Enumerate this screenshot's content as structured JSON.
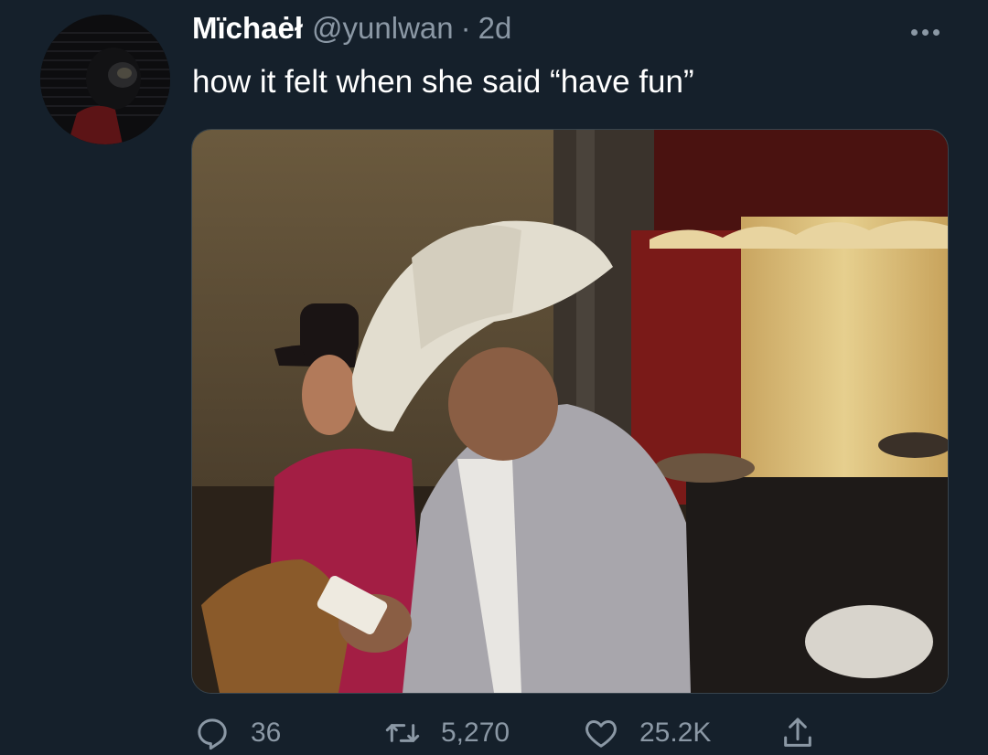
{
  "tweet": {
    "display_name": "Mïchaėł",
    "handle": "@yunlwan",
    "separator": "·",
    "time": "2d",
    "text": "how it felt when she said “have fun”"
  },
  "actions": {
    "reply": {
      "icon": "reply-icon",
      "count": "36"
    },
    "retweet": {
      "icon": "retweet-icon",
      "count": "5,270"
    },
    "like": {
      "icon": "heart-icon",
      "count": "25.2K"
    },
    "share": {
      "icon": "share-icon"
    }
  },
  "colors": {
    "background": "#15202b",
    "primary_text": "#ffffff",
    "secondary_text": "#8b98a5"
  }
}
